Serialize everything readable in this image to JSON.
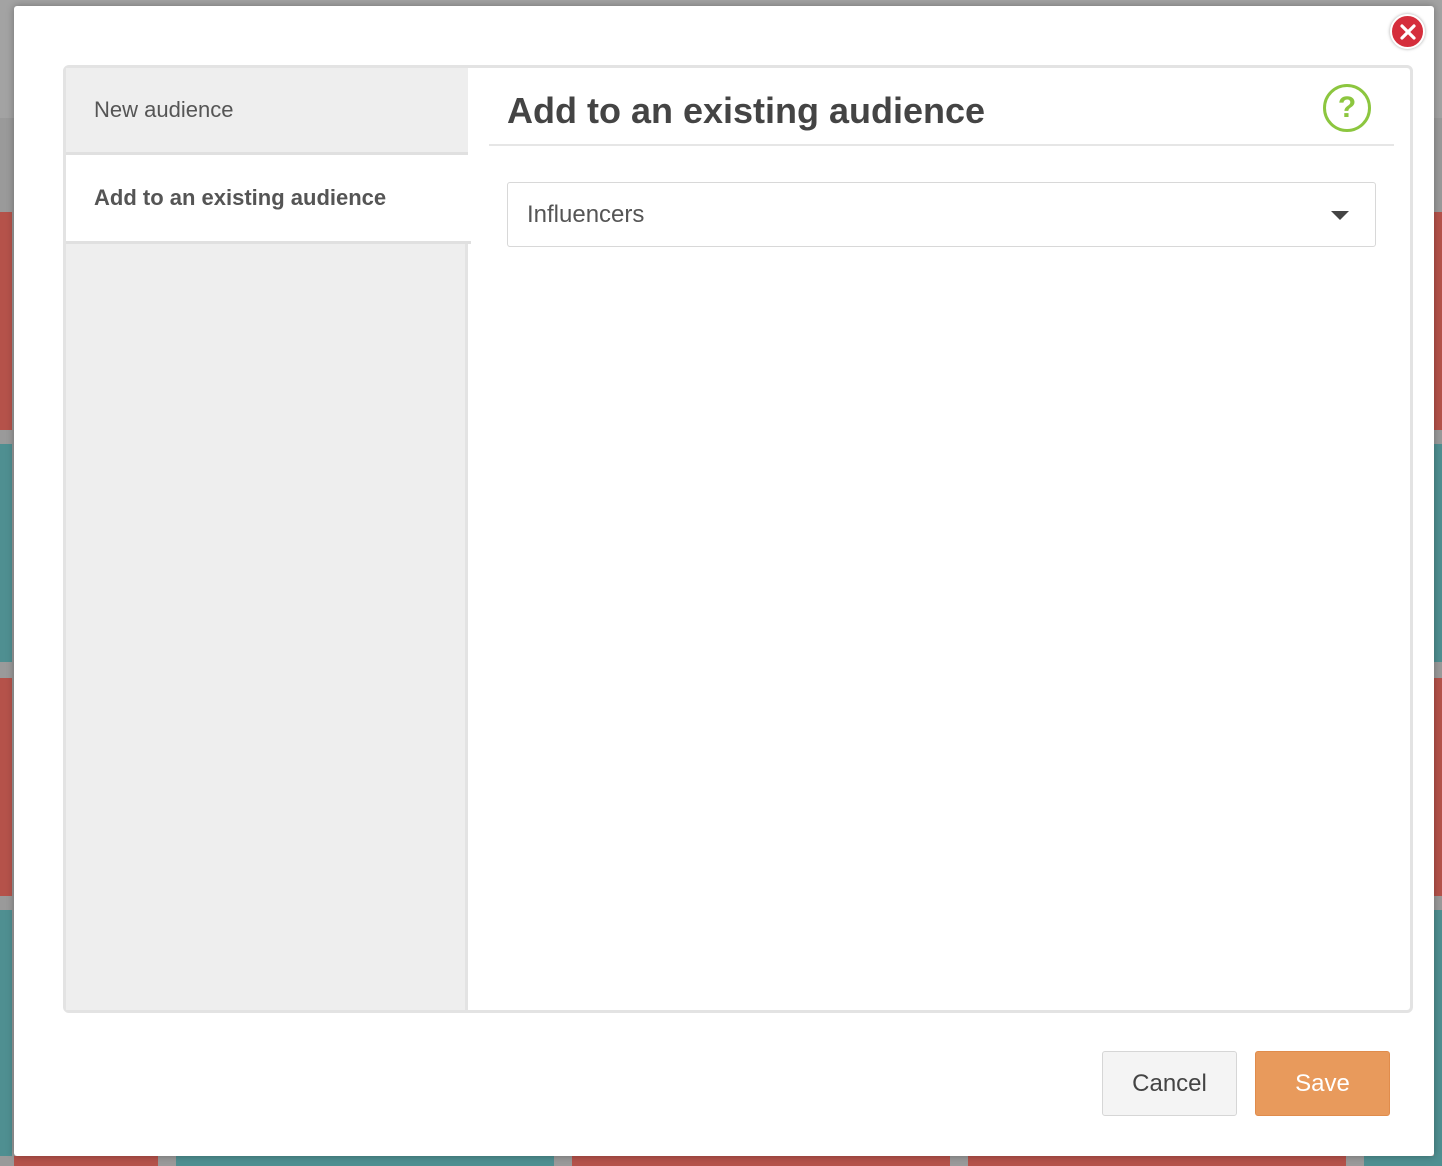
{
  "modal": {
    "tabs": [
      {
        "label": "New audience",
        "active": false
      },
      {
        "label": "Add to an existing audience",
        "active": true
      }
    ],
    "title": "Add to an existing audience",
    "help_icon_glyph": "?",
    "audience_select": {
      "value": "Influencers"
    },
    "cancel_label": "Cancel",
    "save_label": "Save",
    "colors": {
      "accent_save": "#e89a5c",
      "help_green": "#8cc63f",
      "close_red": "#d52e3c"
    }
  }
}
